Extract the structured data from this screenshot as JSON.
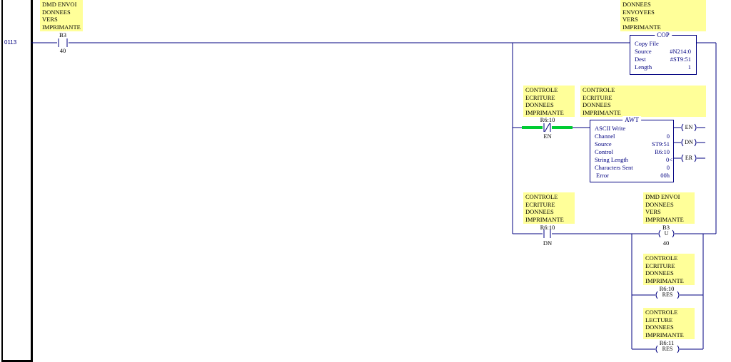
{
  "rung_number": "0113",
  "rung1": {
    "comment": "DMD ENVOI\nDONNEES\nVERS\nIMPRIMANTE",
    "contact_address": "B3",
    "contact_bit": "40"
  },
  "cop": {
    "comment": "DONNEES\nENVOYEES\nVERS\nIMPRIMANTE",
    "title": "COP",
    "name": "Copy File",
    "rows": [
      {
        "label": "Source",
        "value": "#N214:0"
      },
      {
        "label": "Dest",
        "value": "#ST9:51"
      },
      {
        "label": "Length",
        "value": "1"
      }
    ]
  },
  "rung2": {
    "contact_comment": "CONTROLE\nECRITURE\nDONNEES\nIMPRIMANTE",
    "contact_address": "R6:10",
    "contact_bit": "EN",
    "block_comment": "CONTROLE\nECRITURE\nDONNEES\nIMPRIMANTE"
  },
  "awt": {
    "title": "AWT",
    "name": "ASCII Write",
    "rows": [
      {
        "label": "Channel",
        "value": "0"
      },
      {
        "label": "Source",
        "value": "ST9:51"
      },
      {
        "label": "Control",
        "value": "R6:10"
      },
      {
        "label": "String Length",
        "value": "0<"
      },
      {
        "label": "Characters Sent",
        "value": "0"
      },
      {
        "label": "Error",
        "value": "00h"
      }
    ],
    "outputs": [
      "EN",
      "DN",
      "ER"
    ]
  },
  "rung3": {
    "contact_comment": "CONTROLE\nECRITURE\nDONNEES\nIMPRIMANTE",
    "contact_address": "R6:10",
    "contact_bit": "DN",
    "coil1_comment": "DMD ENVOI\nDONNEES\nVERS\nIMPRIMANTE",
    "coil1_address": "B3",
    "coil1_type": "U",
    "coil1_bit": "40",
    "coil2_comment": "CONTROLE\nECRITURE\nDONNEES\nIMPRIMANTE",
    "coil2_address": "R6:10",
    "coil2_type": "RES",
    "coil3_comment": "CONTROLE\nLECTURE\nDONNEES\nIMPRIMANTE",
    "coil3_address": "R6:11",
    "coil3_type": "RES"
  },
  "colors": {
    "wire": "#000080",
    "comment_bg": "#ffff99",
    "energized": "#00cc33"
  }
}
